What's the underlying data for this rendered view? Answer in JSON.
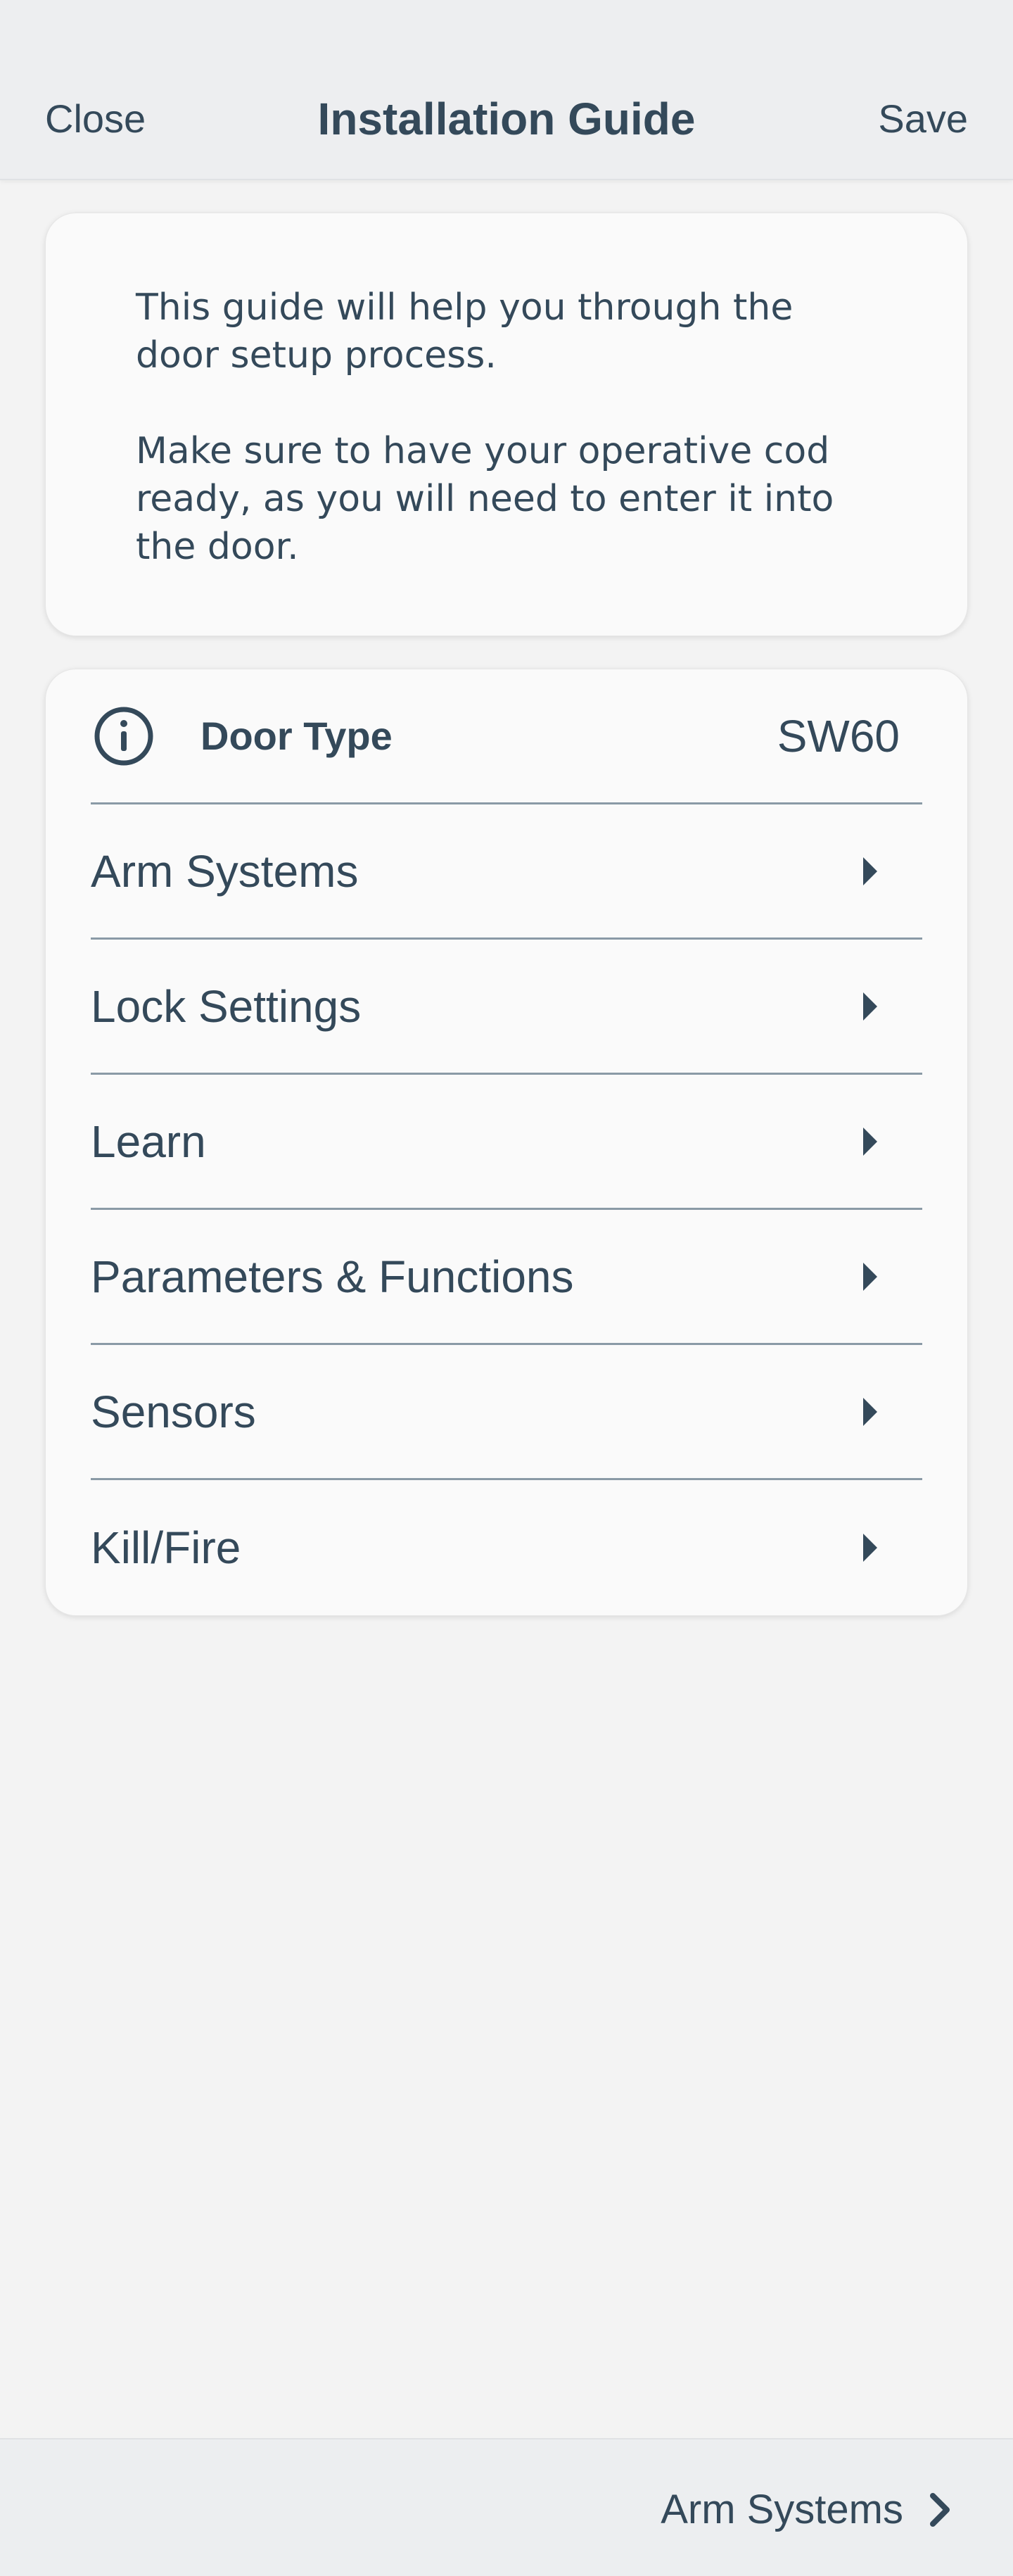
{
  "header": {
    "close_label": "Close",
    "title": "Installation Guide",
    "save_label": "Save"
  },
  "intro": {
    "paragraph_1": "This guide will help you through the door setup process.",
    "paragraph_2": "Make sure to have your operative cod ready, as you will need to enter it into the door."
  },
  "door_type": {
    "icon": "info-icon",
    "label": "Door Type",
    "value": "SW60"
  },
  "menu": {
    "items": [
      {
        "label": "Arm Systems",
        "icon": "caret-right-icon"
      },
      {
        "label": "Lock Settings",
        "icon": "caret-right-icon"
      },
      {
        "label": "Learn",
        "icon": "caret-right-icon"
      },
      {
        "label": "Parameters & Functions",
        "icon": "caret-right-icon"
      },
      {
        "label": "Sensors",
        "icon": "caret-right-icon"
      },
      {
        "label": "Kill/Fire",
        "icon": "caret-right-icon"
      }
    ]
  },
  "footer": {
    "next_label": "Arm Systems",
    "next_icon": "chevron-right-icon"
  },
  "colors": {
    "text": "#34495a",
    "header_bg": "#edeef0",
    "page_bg": "#f3f3f3",
    "card_bg": "#fafafa",
    "divider": "#8a9aa6"
  }
}
